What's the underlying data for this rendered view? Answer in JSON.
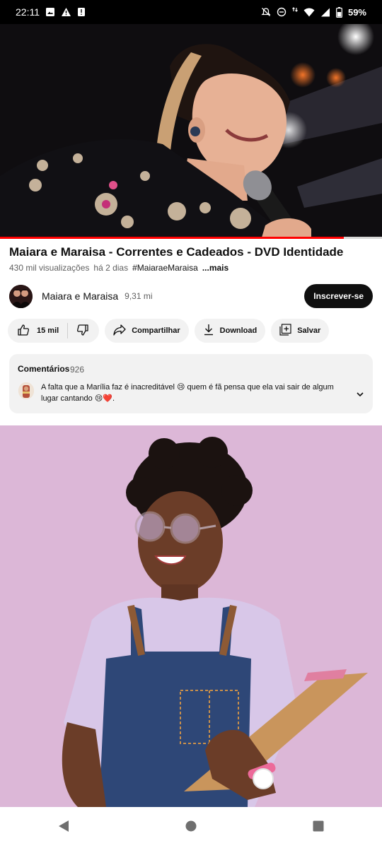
{
  "status_bar": {
    "time": "22:11",
    "battery": "59%",
    "left_icons": [
      "image-icon",
      "warning-icon",
      "alert-icon"
    ],
    "right_icons": [
      "mute-icon",
      "dnd-icon",
      "data-icon",
      "wifi-icon",
      "signal-icon",
      "battery-icon"
    ]
  },
  "video": {
    "progress_fraction": 0.9
  },
  "title": "Maiara e Maraisa - Correntes e Cadeados - DVD Identidade",
  "meta": {
    "views": "430 mil visualizações",
    "date": "há 2 dias",
    "hashtag": "#MaiaraeMaraisa",
    "more": "...mais"
  },
  "channel": {
    "name": "Maiara e Maraisa",
    "subscribers": "9,31 mi",
    "subscribe_label": "Inscrever-se"
  },
  "actions": {
    "likes": "15 mil",
    "share": "Compartilhar",
    "download": "Download",
    "save": "Salvar"
  },
  "comments": {
    "heading": "Comentários",
    "count": "926",
    "top_comment": "A falta que a Marília faz é inacreditável 😢 quem é fã pensa que ela vai sair de algum lugar cantando 😢❤️."
  },
  "colors": {
    "accent": "#ff0000",
    "subscribe_bg": "#0f0f0f",
    "pill_bg": "#f2f2f2"
  }
}
